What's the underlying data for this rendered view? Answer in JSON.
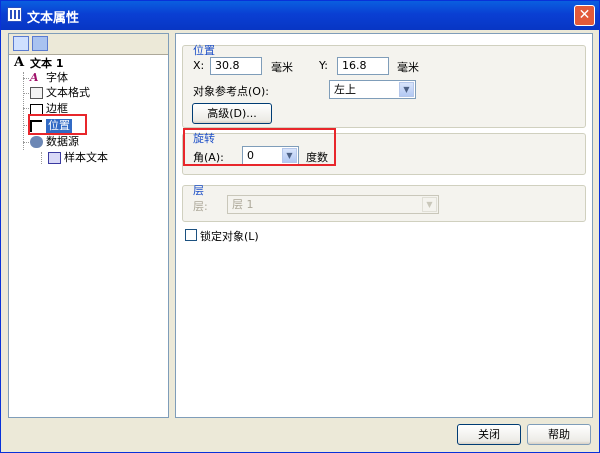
{
  "window": {
    "title": "文本属性",
    "close_glyph": "✕"
  },
  "tree": {
    "items": [
      {
        "label": "文本 1",
        "icon": "text-a-icon"
      },
      {
        "label": "字体",
        "icon": "font-icon"
      },
      {
        "label": "文本格式",
        "icon": "text-format-icon"
      },
      {
        "label": "边框",
        "icon": "border-icon"
      },
      {
        "label": "位置",
        "icon": "position-icon",
        "selected": true
      },
      {
        "label": "数据源",
        "icon": "data-source-icon"
      },
      {
        "label": "样本文本",
        "icon": "sample-text-icon"
      }
    ]
  },
  "position_group": {
    "title": "位置",
    "x_label": "X:",
    "x_value": "30.8",
    "x_unit": "毫米",
    "y_label": "Y:",
    "y_value": "16.8",
    "y_unit": "毫米",
    "ref_label": "对象参考点(O):",
    "ref_value": "左上",
    "advanced_button": "高级(D)..."
  },
  "rotation_group": {
    "title": "旋转",
    "angle_label": "角(A):",
    "angle_value": "0",
    "angle_unit": "度数"
  },
  "layer_group": {
    "title": "层",
    "layer_label": "层:",
    "layer_value": "层 1"
  },
  "lock_label": "锁定对象(L)",
  "buttons": {
    "close": "关闭",
    "help": "帮助"
  },
  "colors": {
    "title_bar": "#0a3fd3",
    "group_title": "#1b4ec7",
    "highlight_box": "#e8262b",
    "selection": "#316ac5"
  }
}
